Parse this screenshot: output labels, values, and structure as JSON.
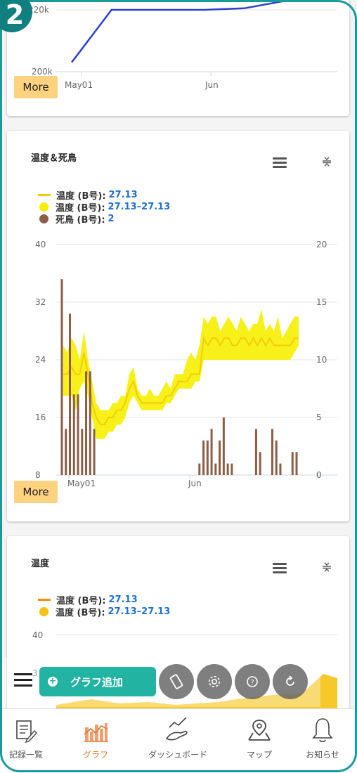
{
  "step_badge": "2",
  "top_card": {
    "y_ticks": [
      "220k",
      "200k"
    ],
    "x_ticks": [
      "May01",
      "Jun"
    ],
    "more_label": "More",
    "line_color": "#2b3fd6",
    "series_points": [
      [
        0,
        203000
      ],
      [
        0.15,
        220000
      ],
      [
        0.5,
        220000
      ],
      [
        0.65,
        220500
      ],
      [
        1,
        226000
      ]
    ]
  },
  "card2": {
    "title": "温度＆死鳥",
    "legend": [
      {
        "type": "line",
        "color": "#f2cc0c",
        "label": "温度 (B号):",
        "value": "27.13"
      },
      {
        "type": "dot",
        "color": "#f7ef00",
        "label": "温度 (B号):",
        "value": "27.13–27.13"
      },
      {
        "type": "dot",
        "color": "#8b5e45",
        "label": "死鳥 (B号):",
        "value": "2"
      }
    ],
    "y_left_ticks": [
      "40",
      "32",
      "24",
      "16",
      "8"
    ],
    "y_right_ticks": [
      "20",
      "15",
      "10",
      "5",
      "0"
    ],
    "x_ticks": [
      "May01",
      "Jun"
    ],
    "more_label": "More"
  },
  "card3": {
    "title": "温度",
    "legend": [
      {
        "type": "line",
        "color": "#ff8c00",
        "label": "温度 (B号):",
        "value": "27.13"
      },
      {
        "type": "dot",
        "color": "#f5c211",
        "label": "温度 (B号):",
        "value": "27.13–27.13"
      }
    ],
    "y_left_ticks": [
      "40",
      "3"
    ]
  },
  "chart_data": {
    "type": "bar",
    "title": "温度＆死鳥",
    "x_ticks": [
      "May01",
      "Jun"
    ],
    "ylim_left": [
      8,
      40
    ],
    "ylim_right": [
      0,
      20
    ],
    "series": [
      {
        "name": "温度 (B号)",
        "type": "line",
        "axis": "left",
        "values": [
          22,
          22,
          23,
          22,
          22,
          25,
          22,
          18,
          16,
          15,
          15,
          16,
          16,
          17,
          17,
          18,
          20,
          21,
          19,
          18,
          18,
          18,
          18,
          18,
          18,
          19,
          19,
          20,
          21,
          21,
          21,
          22,
          22,
          22,
          27,
          26,
          27,
          27,
          26,
          27,
          27,
          26,
          26,
          27,
          27,
          26,
          27,
          26,
          27,
          26,
          27,
          26,
          26,
          26,
          26,
          26,
          27,
          27
        ]
      },
      {
        "name": "温度 (B号)",
        "type": "band",
        "axis": "left",
        "lower": [
          19,
          19,
          19,
          17,
          20,
          21,
          19,
          16,
          13,
          13,
          13,
          14,
          14,
          15,
          15,
          16,
          18,
          19,
          18,
          17,
          17,
          17,
          17,
          17,
          17,
          18,
          18,
          19,
          20,
          20,
          20,
          20,
          21,
          21,
          24,
          24,
          24,
          24,
          24,
          24,
          24,
          24,
          24,
          24,
          24,
          24,
          24,
          24,
          24,
          24,
          24,
          24,
          24,
          24,
          24,
          24,
          25,
          26
        ],
        "upper": [
          26,
          25,
          27,
          26,
          24,
          28,
          24,
          21,
          18,
          17,
          17,
          17,
          18,
          18,
          19,
          19,
          22,
          23,
          20,
          19,
          19,
          20,
          19,
          19,
          20,
          21,
          20,
          22,
          22,
          22,
          24,
          25,
          24,
          26,
          30,
          29,
          30,
          30,
          28,
          29,
          30,
          29,
          28,
          30,
          29,
          28,
          29,
          29,
          31,
          28,
          29,
          28,
          30,
          27,
          28,
          29,
          30,
          30
        ]
      },
      {
        "name": "死鳥 (B号)",
        "type": "bar",
        "axis": "right",
        "values": [
          17,
          4,
          14,
          7,
          7,
          4,
          9,
          9,
          4,
          0,
          0,
          0,
          0,
          0,
          0,
          0,
          0,
          0,
          0,
          0,
          0,
          0,
          0,
          0,
          0,
          0,
          0,
          0,
          0,
          0,
          0,
          0,
          0,
          0,
          1,
          3,
          3,
          4,
          1,
          3,
          5,
          1,
          1,
          0,
          0,
          0,
          0,
          0,
          4,
          2,
          0,
          0,
          4,
          3,
          1,
          0,
          0,
          2,
          2
        ]
      }
    ]
  },
  "toolbar": {
    "add_graph_label": "グラフ追加",
    "buttons": [
      "rotate-icon",
      "gear-icon",
      "help-icon",
      "refresh-icon"
    ]
  },
  "bottom_nav": [
    {
      "label": "記録一覧",
      "icon": "notepad-icon"
    },
    {
      "label": "グラフ",
      "icon": "bar-chart-icon"
    },
    {
      "label": "ダッシュボード",
      "icon": "hand-chart-icon"
    },
    {
      "label": "マップ",
      "icon": "map-pin-icon"
    },
    {
      "label": "お知らせ",
      "icon": "bell-icon"
    }
  ]
}
